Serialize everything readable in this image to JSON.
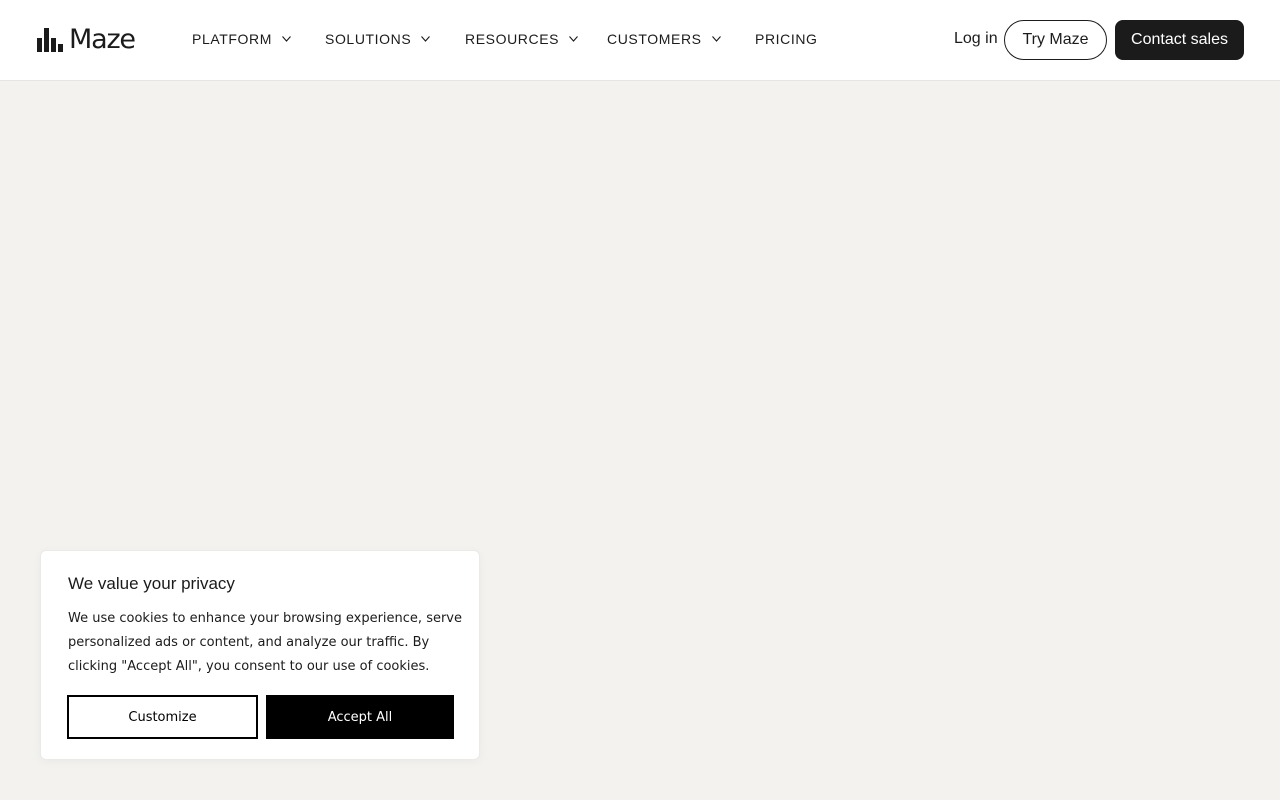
{
  "colors": {
    "page_background": "#f3f2ee",
    "header_background": "#ffffff",
    "primary_dark": "#1b1b1b",
    "accept_background": "#000000"
  },
  "header": {
    "logo": {
      "text": "Maze",
      "icon": "maze-logo-icon"
    },
    "nav": [
      {
        "label": "PLATFORM",
        "has_dropdown": true
      },
      {
        "label": "SOLUTIONS",
        "has_dropdown": true
      },
      {
        "label": "RESOURCES",
        "has_dropdown": true
      },
      {
        "label": "CUSTOMERS",
        "has_dropdown": true
      },
      {
        "label": "PRICING",
        "has_dropdown": false
      }
    ],
    "login_label": "Log in",
    "try_label": "Try Maze",
    "contact_label": "Contact sales"
  },
  "cookie_banner": {
    "title": "We value your privacy",
    "body": "We use cookies to enhance your browsing experience, serve personalized ads or content, and analyze our traffic. By clicking \"Accept All\", you consent to our use of cookies.",
    "customize_label": "Customize",
    "accept_label": "Accept All"
  }
}
